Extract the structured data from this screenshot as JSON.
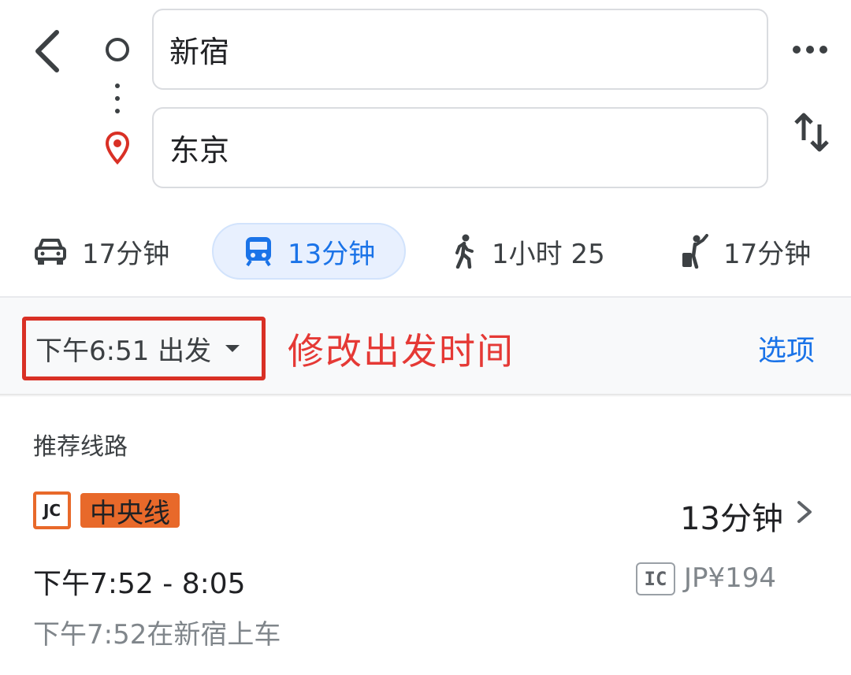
{
  "search": {
    "origin": "新宿",
    "destination": "东京"
  },
  "modes": [
    {
      "name": "driving",
      "label": "17分钟",
      "icon": "car-icon",
      "selected": false
    },
    {
      "name": "transit",
      "label": "13分钟",
      "icon": "train-icon",
      "selected": true
    },
    {
      "name": "walking",
      "label": "1小时 25",
      "icon": "walk-icon",
      "selected": false
    },
    {
      "name": "ride",
      "label": "17分钟",
      "icon": "ride-hail-icon",
      "selected": false
    }
  ],
  "time_bar": {
    "depart_label": "下午6:51 出发",
    "annotation": "修改出发时间",
    "options_label": "选项"
  },
  "results": {
    "section_title": "推荐线路",
    "route": {
      "operator_badge": "JC",
      "line_name": "中央线",
      "duration": "13分钟",
      "time_range": "下午7:52 - 8:05",
      "card_badge": "IC",
      "fare": "JP¥194",
      "boarding_info": "下午7:52在新宿上车"
    }
  },
  "colors": {
    "accent_blue": "#1a73e8",
    "annotation_red": "#e53935",
    "line_orange": "#e8692a",
    "transit_chip_bg": "#e8f0fe"
  }
}
